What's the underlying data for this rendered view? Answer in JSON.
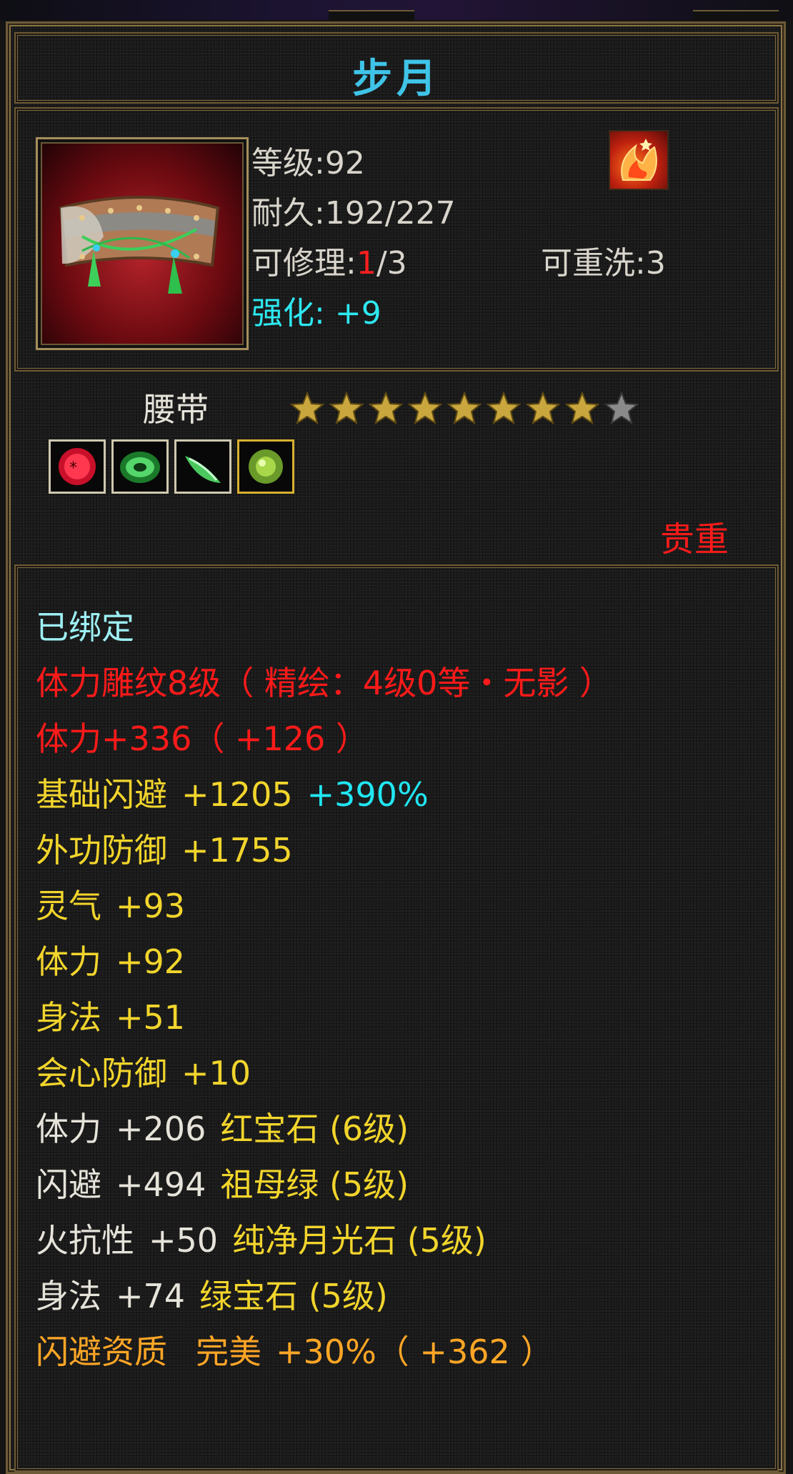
{
  "item": {
    "name": "步月",
    "level_label": "等级",
    "level": ":92",
    "durability_label": "耐久",
    "durability": ":192/227",
    "repair_label": "可修理",
    "repair_prefix": ":",
    "repair_current": "1",
    "repair_total": "/3",
    "rewash_label": "可重洗",
    "rewash_value": ":3",
    "enhance_label": "强化:",
    "enhance_value": "+9",
    "type": "腰带",
    "rarity": "贵重",
    "stars_filled": 8,
    "stars_total": 9,
    "icon": "belt-icon",
    "badge_icon": "flame-badge-icon",
    "gem_slots": [
      "red-gem-icon",
      "green-gem-icon",
      "green-jade-icon",
      "green-pearl-icon"
    ]
  },
  "attributes": {
    "bound": "已绑定",
    "engrave": "体力雕纹8级（ 精绘：4级0等・无影 ）",
    "stamina_bonus": "体力+336（ +126 ）",
    "dodge_base_label": "基础闪避",
    "dodge_base_value": "+1205",
    "dodge_base_percent": "+390%",
    "lines_yellow": [
      {
        "label": "外功防御",
        "value": "+1755"
      },
      {
        "label": "灵气",
        "value": "+93"
      },
      {
        "label": "体力",
        "value": "+92"
      },
      {
        "label": "身法",
        "value": "+51"
      },
      {
        "label": "会心防御",
        "value": "+10"
      }
    ],
    "gem_lines": [
      {
        "label": "体力",
        "value": "+206",
        "gem": "红宝石 (6级)"
      },
      {
        "label": "闪避",
        "value": "+494",
        "gem": "祖母绿 (5级)"
      },
      {
        "label": "火抗性",
        "value": "+50",
        "gem": "纯净月光石 (5级)"
      },
      {
        "label": "身法",
        "value": "+74",
        "gem": "绿宝石 (5级)"
      }
    ],
    "quality_label": "闪避资质",
    "quality_grade": "完美",
    "quality_value": "+30%（ +362 ）"
  },
  "colors": {
    "title": "#3fc4e8",
    "red": "#ff1a1a",
    "yellow": "#f2d52c",
    "orange": "#ffa626",
    "cyan": "#21e6f2",
    "border": "#6d5a36"
  }
}
